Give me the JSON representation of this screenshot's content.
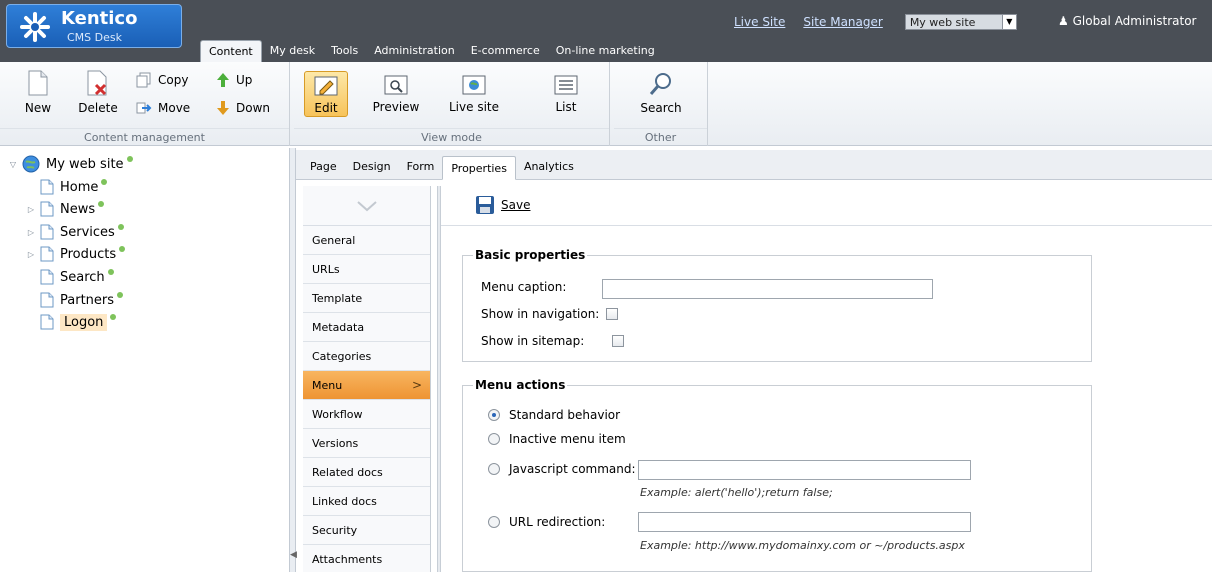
{
  "header": {
    "logo": {
      "name": "Kentico",
      "product": "CMS Desk"
    },
    "links": [
      "Live Site",
      "Site Manager"
    ],
    "site_selector": "My web site",
    "user": "Global Administrator",
    "tabs": [
      "Content",
      "My desk",
      "Tools",
      "Administration",
      "E-commerce",
      "On-line marketing"
    ],
    "active_tab": "Content"
  },
  "ribbon": {
    "content_management": {
      "caption": "Content management",
      "new": "New",
      "delete": "Delete",
      "copy": "Copy",
      "move": "Move",
      "up": "Up",
      "down": "Down"
    },
    "view_mode": {
      "caption": "View mode",
      "edit": "Edit",
      "preview": "Preview",
      "live_site": "Live site",
      "list": "List"
    },
    "other": {
      "caption": "Other",
      "search": "Search"
    }
  },
  "tree": {
    "root": "My web site",
    "nodes": [
      {
        "label": "Home",
        "expandable": false
      },
      {
        "label": "News",
        "expandable": true
      },
      {
        "label": "Services",
        "expandable": true
      },
      {
        "label": "Products",
        "expandable": true
      },
      {
        "label": "Search",
        "expandable": false
      },
      {
        "label": "Partners",
        "expandable": false
      },
      {
        "label": "Logon",
        "expandable": false,
        "selected": true
      }
    ]
  },
  "subtabs": [
    "Page",
    "Design",
    "Form",
    "Properties",
    "Analytics"
  ],
  "active_subtab": "Properties",
  "menu": {
    "items": [
      "General",
      "URLs",
      "Template",
      "Metadata",
      "Categories",
      "Menu",
      "Workflow",
      "Versions",
      "Related docs",
      "Linked docs",
      "Security",
      "Attachments"
    ],
    "active": "Menu"
  },
  "content": {
    "save_label": "Save",
    "basic": {
      "legend": "Basic properties",
      "menu_caption_label": "Menu caption:",
      "menu_caption_value": "",
      "show_in_navigation_label": "Show in navigation:",
      "show_in_sitemap_label": "Show in sitemap:"
    },
    "actions": {
      "legend": "Menu actions",
      "standard": "Standard behavior",
      "inactive": "Inactive menu item",
      "javascript": "Javascript command:",
      "javascript_example": "Example: alert('hello');return false;",
      "redirect": "URL redirection:",
      "redirect_example": "Example: http://www.mydomainxy.com or ~/products.aspx"
    }
  },
  "colors": {
    "header_bg": "#4a4f56",
    "logo_blue": "#1a5fb6",
    "active_menu": "#ee9433",
    "status_dot": "#7ec35b"
  }
}
